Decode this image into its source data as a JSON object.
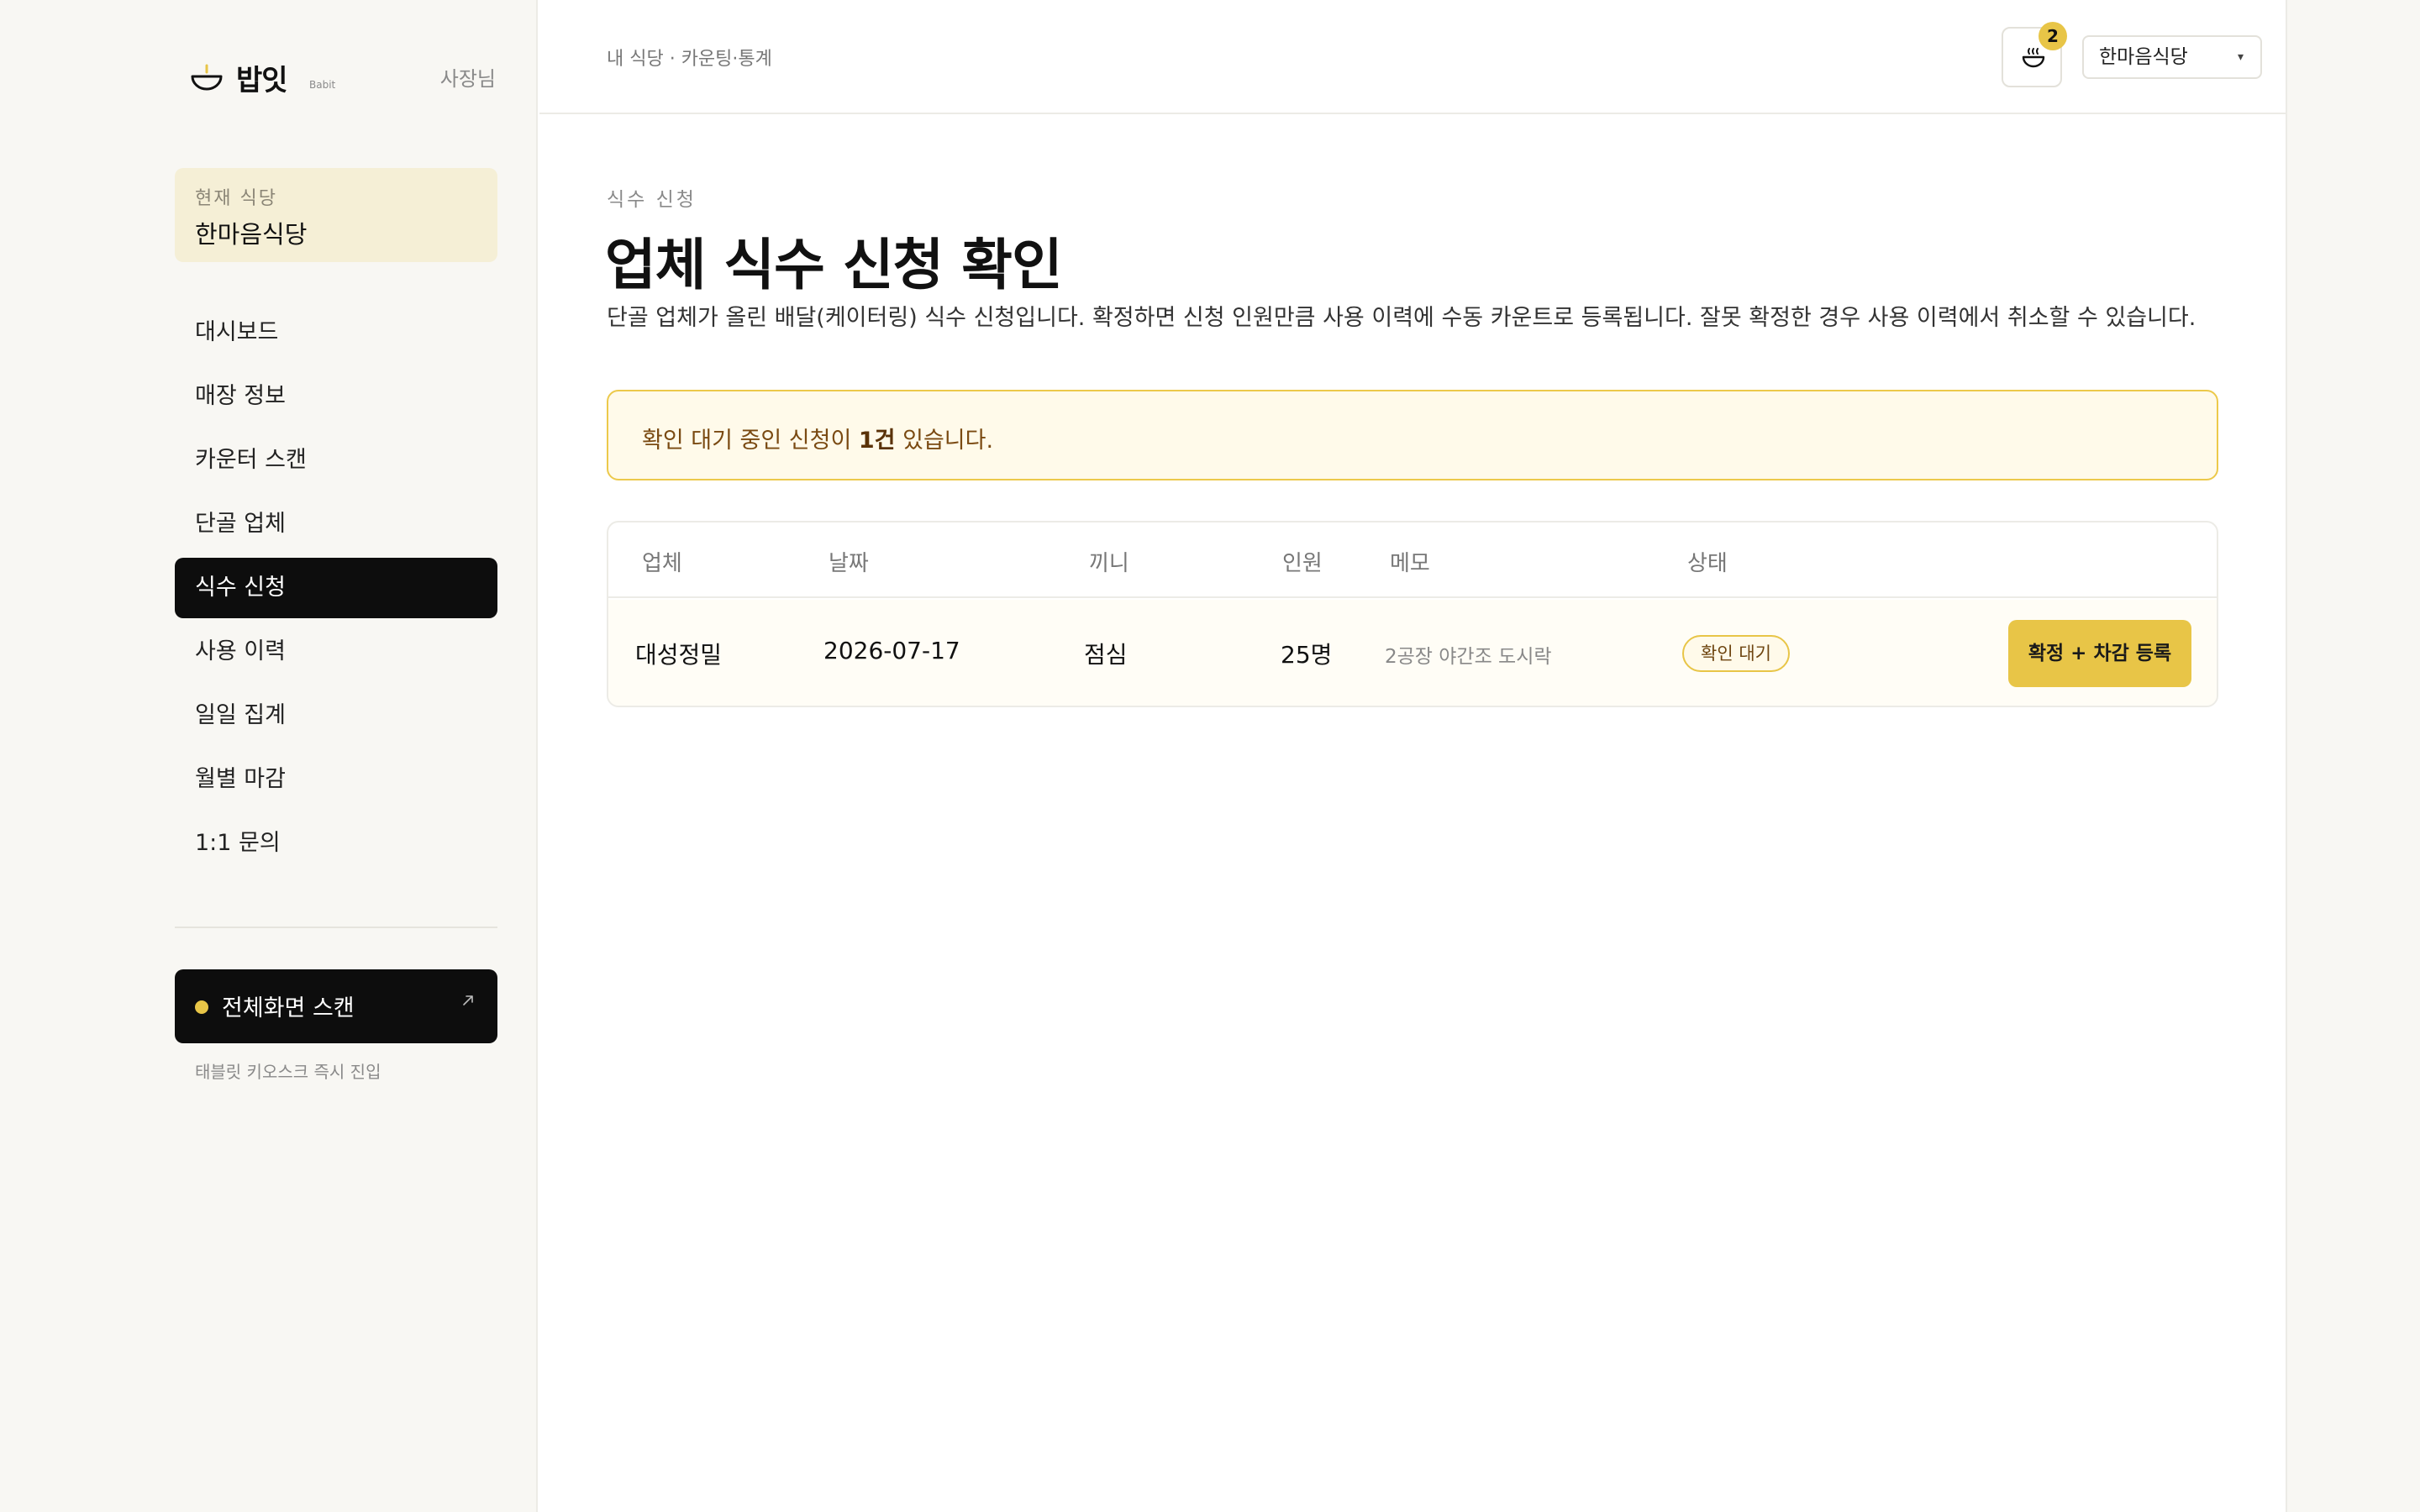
{
  "brand": {
    "name": "밥잇",
    "sub": "Babit",
    "role": "사장님",
    "accent_color": "#e8c547"
  },
  "sidebar": {
    "current_label": "현재 식당",
    "current_name": "한마음식당",
    "items": [
      {
        "label": "대시보드",
        "active": false
      },
      {
        "label": "매장 정보",
        "active": false
      },
      {
        "label": "카운터 스캔",
        "active": false
      },
      {
        "label": "단골 업체",
        "active": false
      },
      {
        "label": "식수 신청",
        "active": true
      },
      {
        "label": "사용 이력",
        "active": false
      },
      {
        "label": "일일 집계",
        "active": false
      },
      {
        "label": "월별 마감",
        "active": false
      },
      {
        "label": "1:1 문의",
        "active": false
      }
    ],
    "scan_button_label": "전체화면 스캔",
    "scan_caption": "태블릿 키오스크 즉시 진입"
  },
  "topbar": {
    "breadcrumb": "내 식당 · 카운팅·통계",
    "notification_count": "2",
    "store_select": "한마음식당",
    "store_caret": "▾"
  },
  "page": {
    "eyebrow": "식수 신청",
    "title": "업체 식수 신청 확인",
    "description": "단골 업체가 올린 배달(케이터링) 식수 신청입니다. 확정하면 신청 인원만큼 사용 이력에 수동 카운트로 등록됩니다. 잘못 확정한 경우 사용 이력에서 취소할 수 있습니다."
  },
  "alert": {
    "prefix": "확인 대기 중인 신청이 ",
    "count": "1건",
    "suffix": " 있습니다."
  },
  "table": {
    "columns": [
      "업체",
      "날짜",
      "끼니",
      "인원",
      "메모",
      "상태"
    ],
    "rows": [
      {
        "company": "대성정밀",
        "date": "2026-07-17",
        "meal": "점심",
        "count": "25명",
        "memo": "2공장 야간조 도시락",
        "status": "확인 대기",
        "action": "확정 + 차감 등록"
      }
    ]
  }
}
